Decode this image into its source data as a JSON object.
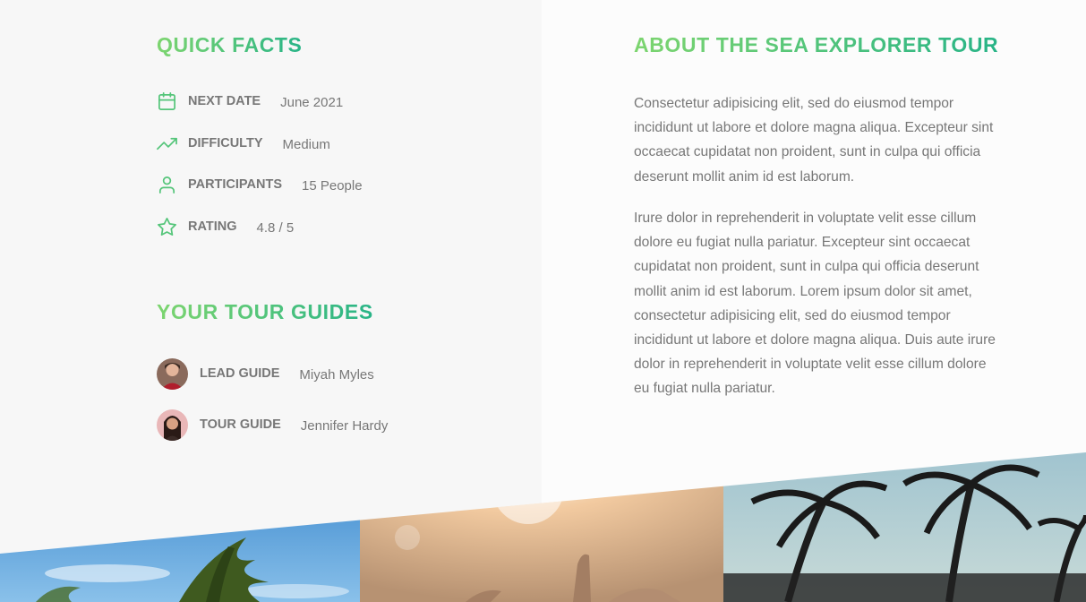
{
  "quick_facts": {
    "heading": "Quick facts",
    "items": [
      {
        "label": "Next date",
        "value": "June 2021",
        "icon": "calendar-icon"
      },
      {
        "label": "Difficulty",
        "value": "Medium",
        "icon": "trending-up-icon"
      },
      {
        "label": "Participants",
        "value": "15 People",
        "icon": "user-icon"
      },
      {
        "label": "Rating",
        "value": "4.8 / 5",
        "icon": "star-icon"
      }
    ]
  },
  "guides": {
    "heading": "Your tour guides",
    "items": [
      {
        "label": "Lead guide",
        "value": "Miyah Myles"
      },
      {
        "label": "Tour guide",
        "value": "Jennifer Hardy"
      }
    ]
  },
  "about": {
    "heading": "About the sea explorer tour",
    "paragraphs": [
      "Consectetur adipisicing elit, sed do eiusmod tempor incididunt ut labore et dolore magna aliqua. Excepteur sint occaecat cupidatat non proident, sunt in culpa qui officia deserunt mollit anim id est laborum.",
      "Irure dolor in reprehenderit in voluptate velit esse cillum dolore eu fugiat nulla pariatur. Excepteur sint occaecat cupidatat non proident, sunt in culpa qui officia deserunt mollit anim id est laborum. Lorem ipsum dolor sit amet, consectetur adipisicing elit, sed do eiusmod tempor incididunt ut labore et dolore magna aliqua. Duis aute irure dolor in reprehenderit in voluptate velit esse cillum dolore eu fugiat nulla pariatur."
    ]
  },
  "colors": {
    "accent_start": "#7dd56f",
    "accent_end": "#28b487",
    "text": "#777777"
  }
}
